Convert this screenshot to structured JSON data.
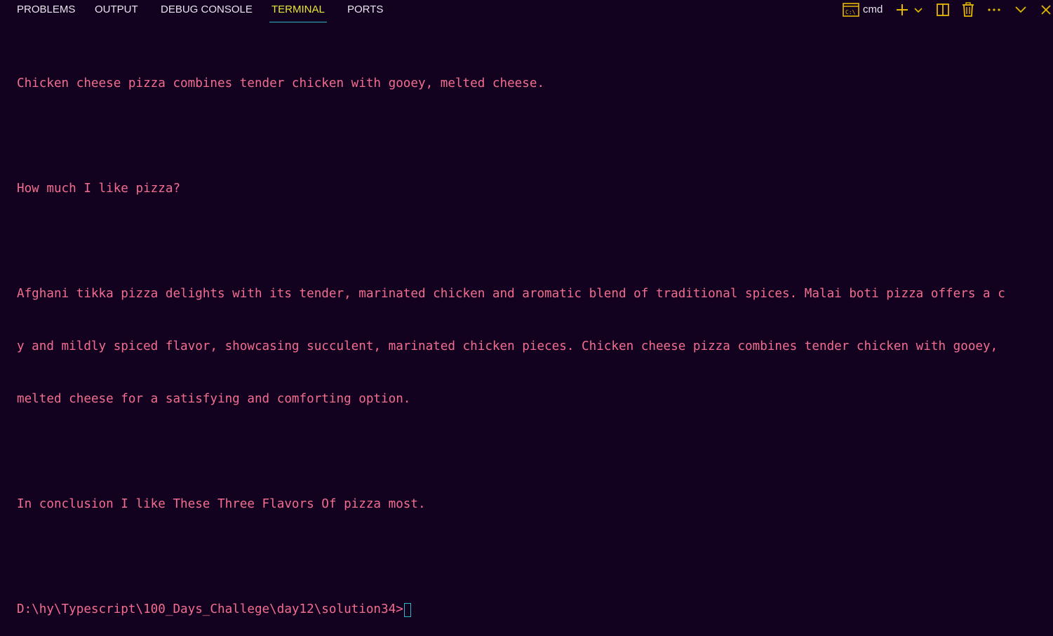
{
  "panel": {
    "tabs": [
      {
        "label": "PROBLEMS",
        "active": false
      },
      {
        "label": "OUTPUT",
        "active": false
      },
      {
        "label": "DEBUG CONSOLE",
        "active": false
      },
      {
        "label": "TERMINAL",
        "active": true
      },
      {
        "label": "PORTS",
        "active": false
      }
    ],
    "shell_label": "cmd",
    "icons": {
      "shell": "terminal-cmd-icon",
      "new_terminal": "plus-icon",
      "launch_profile": "chevron-down-icon",
      "split": "split-terminal-icon",
      "kill": "trash-icon",
      "more": "ellipsis-icon",
      "maximize": "chevron-down-icon",
      "close": "close-icon"
    },
    "accent_color": "#e6b800"
  },
  "terminal": {
    "lines": [
      "Chicken cheese pizza combines tender chicken with gooey, melted cheese.",
      "",
      "How much I like pizza?",
      "",
      "Afghani tikka pizza delights with its tender, marinated chicken and aromatic blend of traditional spices. Malai boti pizza offers a c",
      "y and mildly spiced flavor, showcasing succulent, marinated chicken pieces. Chicken cheese pizza combines tender chicken with gooey,",
      "melted cheese for a satisfying and comforting option.",
      "",
      "In conclusion I like These Three Flavors Of pizza most.",
      ""
    ],
    "prompt": "D:\\hy\\Typescript\\100_Days_Challege\\day12\\solution34>",
    "text_color": "#f26d8f",
    "background": "#12021f"
  }
}
